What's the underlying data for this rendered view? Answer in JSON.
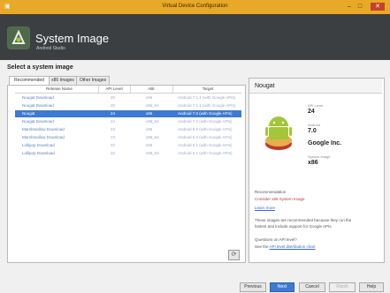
{
  "window": {
    "title": "Virtual Device Configuration"
  },
  "header": {
    "title": "System Image",
    "subtitle": "Android Studio"
  },
  "section_title": "Select a system image",
  "tabs": [
    "Recommended",
    "x86 Images",
    "Other Images"
  ],
  "table": {
    "columns": [
      "Release Name",
      "API Level",
      "ABI",
      "Target"
    ],
    "rows": [
      {
        "release": "Nougat Download",
        "api": "25",
        "abi": "x86",
        "target": "Android 7.1.1 (with Google APIs)"
      },
      {
        "release": "Nougat Download",
        "api": "25",
        "abi": "x86_64",
        "target": "Android 7.1.1 (with Google APIs)"
      },
      {
        "release": "Nougat",
        "api": "24",
        "abi": "x86",
        "target": "Android 7.0 (with Google APIs)"
      },
      {
        "release": "Nougat Download",
        "api": "24",
        "abi": "x86_64",
        "target": "Android 7.0 (with Google APIs)"
      },
      {
        "release": "Marshmallow Download",
        "api": "23",
        "abi": "x86",
        "target": "Android 6.0 (with Google APIs)"
      },
      {
        "release": "Marshmallow Download",
        "api": "23",
        "abi": "x86_64",
        "target": "Android 6.0 (with Google APIs)"
      },
      {
        "release": "Lollipop Download",
        "api": "22",
        "abi": "x86",
        "target": "Android 5.1 (with Google APIs)"
      },
      {
        "release": "Lollipop Download",
        "api": "22",
        "abi": "x86_64",
        "target": "Android 5.1 (with Google APIs)"
      }
    ],
    "selected_index": 2
  },
  "detail": {
    "title": "Nougat",
    "api_level_label": "API Level",
    "api_level": "24",
    "android_label": "Android",
    "android": "7.0",
    "vendor": "Google Inc.",
    "system_image_label": "System Image",
    "system_image": "x86",
    "recommendation_label": "Recommendation",
    "recommendation": "Consider x86 System Image",
    "link": "Learn more",
    "info_line1": "These images are recommended because they run the",
    "info_line2": "fastest and include support for Google APIs.",
    "question": "Questions on API level?",
    "see_prefix": "See the",
    "see_link": "API level distribution chart"
  },
  "buttons": {
    "previous": "Previous",
    "next": "Next",
    "cancel": "Cancel",
    "finish": "Finish",
    "help": "Help"
  },
  "icons": {
    "refresh": "refresh-icon",
    "logo": "android-studio-logo-icon",
    "close": "close-icon"
  }
}
